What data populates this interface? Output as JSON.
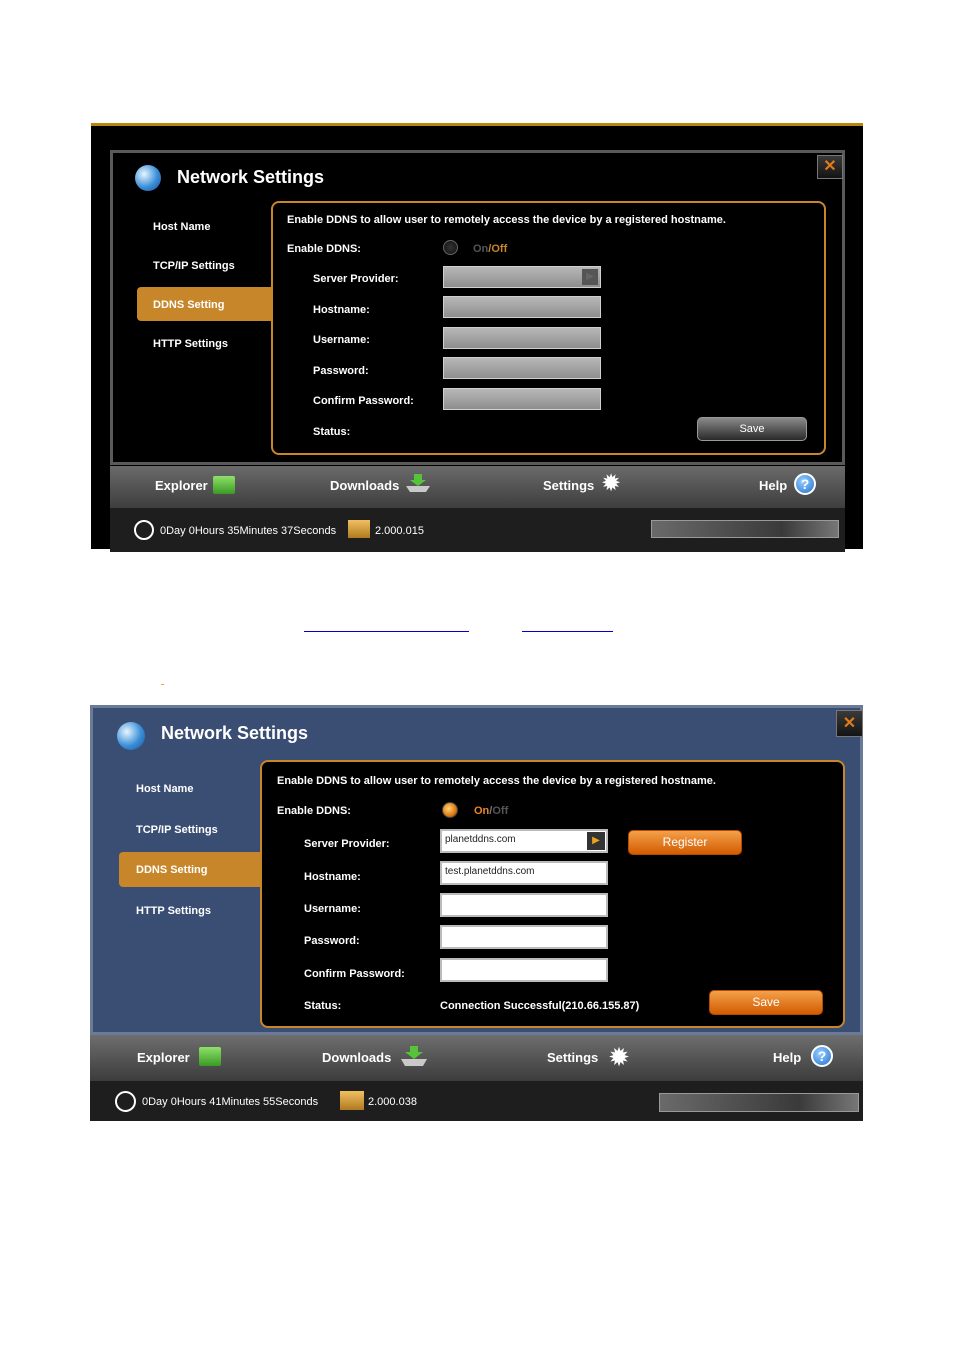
{
  "common": {
    "window_title": "Network Settings",
    "sidebar": [
      "Host Name",
      "TCP/IP Settings",
      "DDNS Setting",
      "HTTP Settings"
    ],
    "description": "Enable DDNS to allow user to remotely access the device by a registered hostname.",
    "labels": {
      "enable_ddns": "Enable DDNS:",
      "server_provider": "Server Provider:",
      "hostname": "Hostname:",
      "username": "Username:",
      "password": "Password:",
      "confirm_password": "Confirm Password:",
      "status": "Status:"
    },
    "toggle_on": "On",
    "toggle_sep": "/",
    "toggle_off": "Off",
    "save": "Save",
    "register": "Register",
    "nav": [
      "Explorer",
      "Downloads",
      "Settings",
      "Help"
    ],
    "help_glyph": "?",
    "close_glyph": "✕"
  },
  "screenshot1": {
    "ddns_enabled": false,
    "server_provider": "",
    "hostname": "",
    "status": "",
    "uptime": "0Day 0Hours 35Minutes 37Seconds",
    "version": "2.000.015"
  },
  "screenshot2": {
    "ddns_enabled": true,
    "server_provider": "planetddns.com",
    "hostname": "test.planetddns.com",
    "username": "",
    "password": "",
    "confirm_password": "",
    "status": "Connection Successful(210.66.155.87)",
    "uptime": "0Day 0Hours 41Minutes 55Seconds",
    "version": "2.000.038"
  },
  "icons": {
    "globe": "globe-icon",
    "close": "close-icon",
    "explorer": "folder-icon",
    "downloads": "download-icon",
    "settings": "gear-icon",
    "help": "help-icon",
    "clock": "clock-icon",
    "version": "package-icon",
    "dropdown": "chevron-right-icon"
  },
  "colors": {
    "accent": "#c8862a",
    "window1_bg": "#000000",
    "window2_bg": "#3a4d73",
    "register_button": "#e8842a"
  }
}
